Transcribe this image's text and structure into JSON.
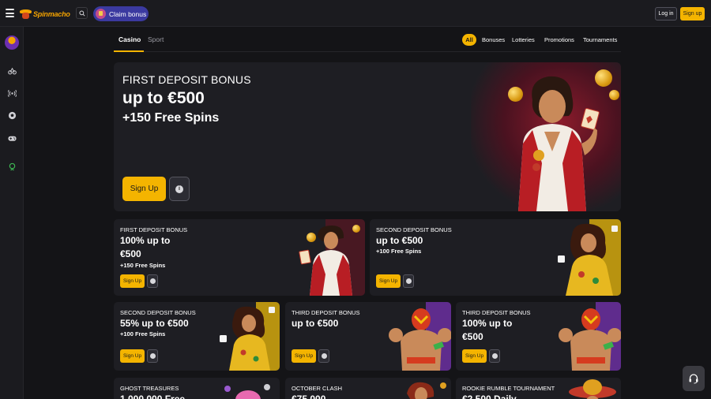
{
  "header": {
    "logo_text": "Spinmacho",
    "claim_bonus": "Claim bonus",
    "login": "Log in",
    "signup": "Sign up"
  },
  "sidebar": {
    "icons": [
      "avatar",
      "bike-icon",
      "broadcast-icon",
      "soccer-ball-icon",
      "gamepad-icon",
      "support-agent-icon"
    ]
  },
  "tabs": {
    "casino": "Casino",
    "sport": "Sport"
  },
  "filters": {
    "all": "All",
    "bonuses": "Bonuses",
    "lotteries": "Lotteries",
    "promotions": "Promotions",
    "tournaments": "Tournaments"
  },
  "hero": {
    "line1": "FIRST DEPOSIT BONUS",
    "line2": "up to €500",
    "line3": "+150 Free Spins",
    "signup": "Sign Up",
    "info": "i"
  },
  "cards": {
    "c1": {
      "title": "FIRST DEPOSIT BONUS",
      "amount": "100% up to €500",
      "spins": "+150 Free Spins",
      "button": "Sign Up"
    },
    "c2": {
      "title": "SECOND DEPOSIT BONUS",
      "amount": "up to €500",
      "spins": "+100 Free Spins",
      "button": "Sign Up"
    },
    "c3": {
      "title": "SECOND DEPOSIT BONUS",
      "amount": "55% up to €500",
      "spins": "+100 Free Spins",
      "button": "Sign Up"
    },
    "c4": {
      "title": "THIRD DEPOSIT BONUS",
      "amount": "up to €500",
      "button": "Sign Up"
    },
    "c5": {
      "title": "THIRD DEPOSIT BONUS",
      "amount": "100% up to €500",
      "button": "Sign Up"
    },
    "c6": {
      "title": "GHOST TREASURES",
      "amount": "1,000,000 Free"
    },
    "c7": {
      "title": "OCTOBER CLASH",
      "amount": "€75,000"
    },
    "c8": {
      "title": "ROOKIE RUMBLE TOURNAMENT",
      "amount": "€2,500 Daily"
    }
  },
  "colors": {
    "accent": "#f4b400",
    "background": "#141417",
    "card": "#1e1e23",
    "claim": "#3b3aa0"
  }
}
